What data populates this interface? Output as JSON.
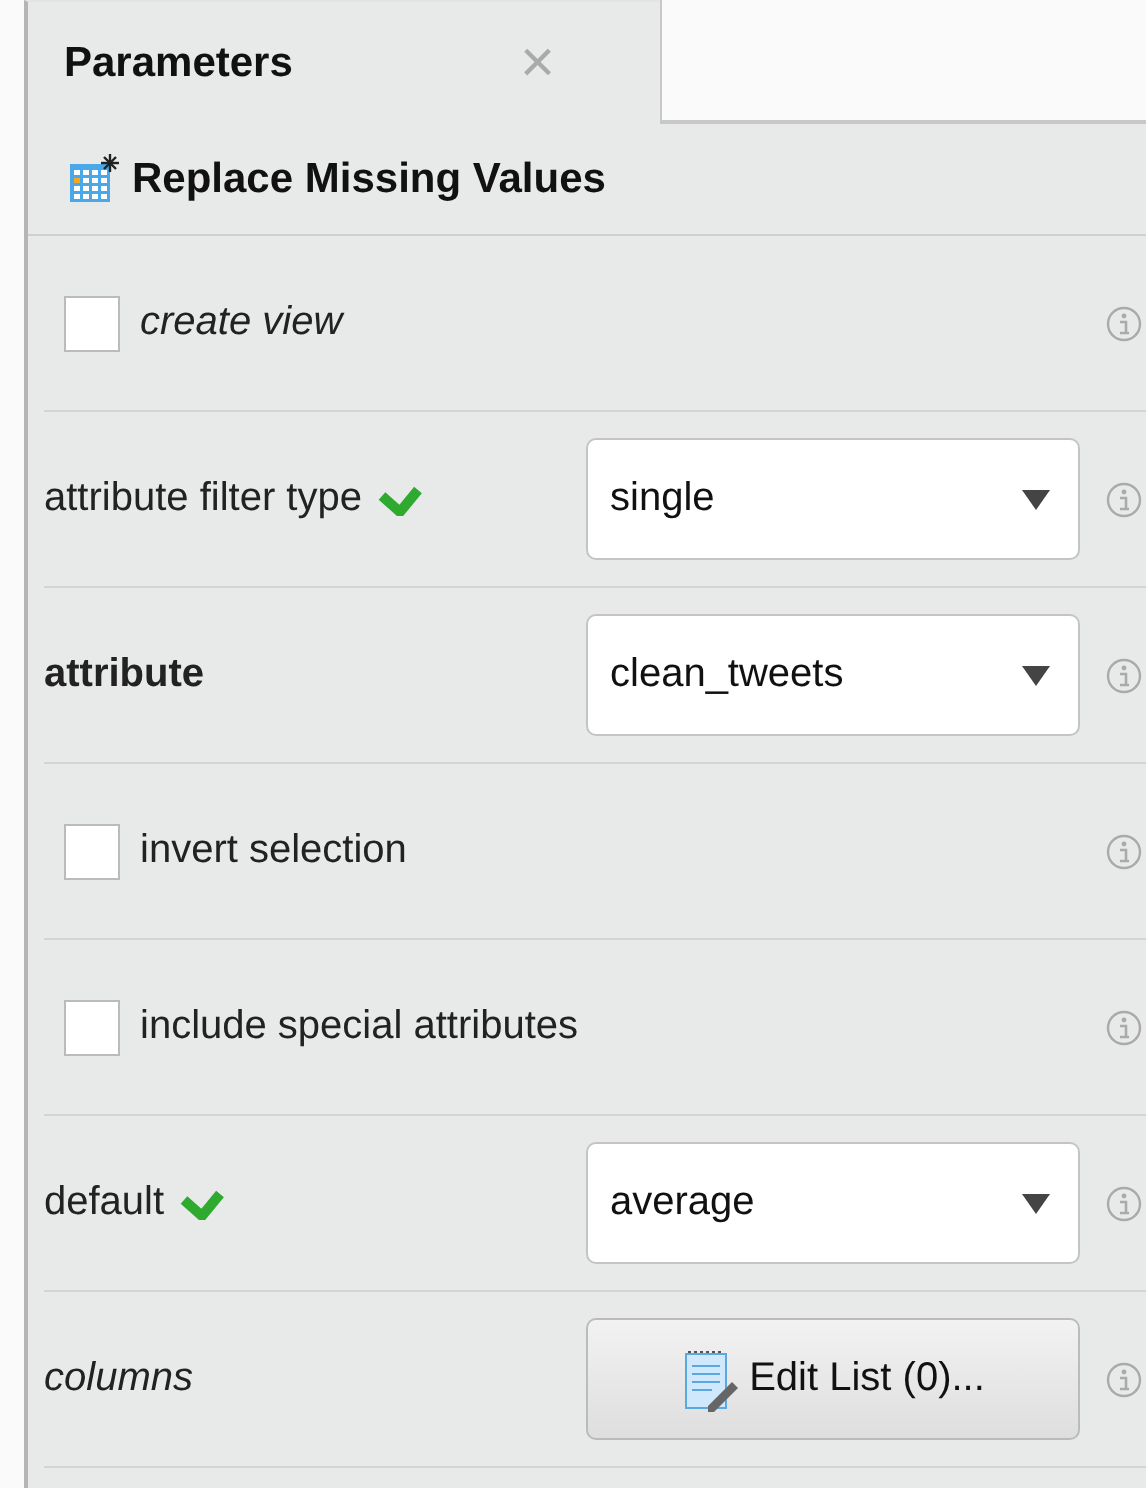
{
  "tab": {
    "label": "Parameters",
    "close": "×"
  },
  "operator": {
    "title": "Replace Missing Values"
  },
  "parameters": [
    {
      "kind": "checkbox",
      "label": "create view",
      "checked": false
    },
    {
      "kind": "dropdown",
      "label": "attribute filter type",
      "confirmed": true,
      "value": "single"
    },
    {
      "kind": "dropdown",
      "label": "attribute",
      "confirmed": false,
      "value": "clean_tweets"
    },
    {
      "kind": "checkbox",
      "label": "invert selection",
      "checked": false
    },
    {
      "kind": "checkbox",
      "label": "include special attributes",
      "checked": false
    },
    {
      "kind": "dropdown",
      "label": "default",
      "confirmed": true,
      "value": "average"
    },
    {
      "kind": "button",
      "label": "columns",
      "button": "Edit List (0)..."
    }
  ]
}
